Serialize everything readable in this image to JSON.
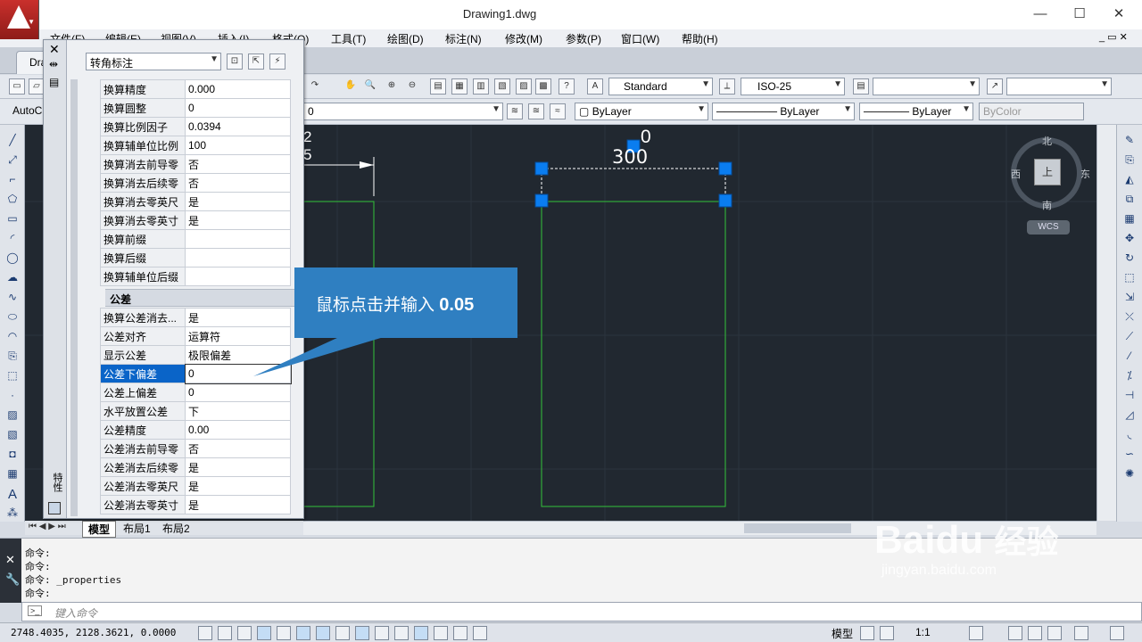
{
  "window": {
    "title": "Drawing1.dwg",
    "minimize": "—",
    "maximize": "☐",
    "close": "✕"
  },
  "menus": [
    "文件(F)",
    "编辑(E)",
    "视图(V)",
    "插入(I)",
    "格式(O)",
    "工具(T)",
    "绘图(D)",
    "标注(N)",
    "修改(M)",
    "参数(P)",
    "窗口(W)",
    "帮助(H)"
  ],
  "doc_tab": {
    "label": "Dra"
  },
  "workspace_combo": "AutoC",
  "layer_combo": "0",
  "styles": {
    "text_style": "Standard",
    "dim_style": "ISO-25"
  },
  "properties_bar": {
    "color": "ByLayer",
    "linetype": "ByLayer",
    "lineweight": "ByLayer",
    "plotstyle": "ByColor"
  },
  "properties_panel": {
    "object_type": "转角标注",
    "strip_label": "特性",
    "alt_rows": [
      {
        "k": "换算精度",
        "v": "0.000"
      },
      {
        "k": "换算圆整",
        "v": "0"
      },
      {
        "k": "换算比例因子",
        "v": "0.0394"
      },
      {
        "k": "换算辅单位比例",
        "v": "100"
      },
      {
        "k": "换算消去前导零",
        "v": "否"
      },
      {
        "k": "换算消去后续零",
        "v": "否"
      },
      {
        "k": "换算消去零英尺",
        "v": "是"
      },
      {
        "k": "换算消去零英寸",
        "v": "是"
      },
      {
        "k": "换算前缀",
        "v": ""
      },
      {
        "k": "换算后缀",
        "v": ""
      },
      {
        "k": "换算辅单位后缀",
        "v": ""
      }
    ],
    "tolerance_section": "公差",
    "tol_rows": [
      {
        "k": "换算公差消去...",
        "v": "是"
      },
      {
        "k": "公差对齐",
        "v": "运算符"
      },
      {
        "k": "显示公差",
        "v": "极限偏差"
      },
      {
        "k": "公差下偏差",
        "v": "0"
      },
      {
        "k": "公差上偏差",
        "v": "0"
      },
      {
        "k": "水平放置公差",
        "v": "下"
      },
      {
        "k": "公差精度",
        "v": "0.00"
      },
      {
        "k": "公差消去前导零",
        "v": "否"
      },
      {
        "k": "公差消去后续零",
        "v": "是"
      },
      {
        "k": "公差消去零英尺",
        "v": "是"
      },
      {
        "k": "公差消去零英寸",
        "v": "是"
      }
    ],
    "selected_row": "公差下偏差"
  },
  "callout": {
    "text": "鼠标点击并输入",
    "value": "0.05"
  },
  "drawing": {
    "dim_left_text": "2",
    "dim_left_text2": "5",
    "dim_right_text": "30",
    "dim_right_text2": "0",
    "dim_right_sup": "0"
  },
  "viewcube": {
    "north": "北",
    "south": "南",
    "east": "东",
    "west": "西",
    "top": "上",
    "wcs": "WCS"
  },
  "layout_tabs": [
    "模型",
    "布局1",
    "布局2"
  ],
  "command_history": [
    "命令:",
    "命令:",
    "命令: _properties",
    "命令:"
  ],
  "command_placeholder": "键入命令",
  "coordinates": "2748.4035, 2128.3621, 0.0000",
  "status_right": {
    "model": "模型",
    "scale": "1:1"
  },
  "watermark": {
    "brand": "Bai",
    "brand2": "du",
    "cn": "经验",
    "url": "jingyan.baidu.com"
  }
}
